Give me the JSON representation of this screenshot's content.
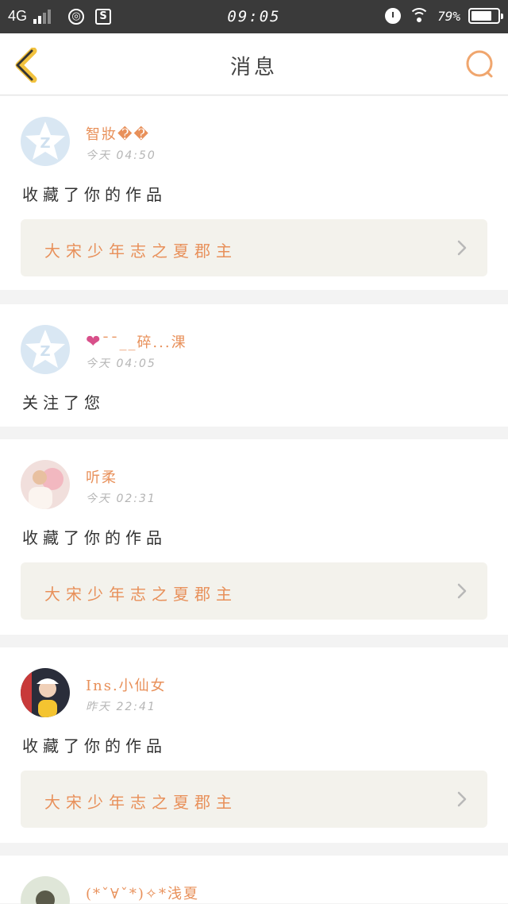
{
  "status_bar": {
    "network": "4G",
    "app1_glyph": "◎",
    "app2_glyph": "S",
    "time": "09:05",
    "battery_text": "79%",
    "battery_level": 0.79
  },
  "header": {
    "title": "消息"
  },
  "icons": {
    "back": "chevron-left-icon",
    "search": "search-icon",
    "chevron": "chevron-right-icon"
  },
  "colors": {
    "accent": "#e8905a",
    "back_icon": "#f2c23e",
    "status_bar_bg": "#3a3a3a",
    "work_bg": "#f3f2ec"
  },
  "notifications": [
    {
      "username": "智妝��",
      "time": "今天 04:50",
      "action": "收藏了你的作品",
      "work_title": "大宋少年志之夏郡主"
    },
    {
      "username_heart": "❤",
      "username": "ˉˉ__碎...淉",
      "time": "今天 04:05",
      "action": "关注了您"
    },
    {
      "username": "听柔",
      "time": "今天 02:31",
      "action": "收藏了你的作品",
      "work_title": "大宋少年志之夏郡主"
    },
    {
      "username": "Ins.小仙女",
      "time": "昨天 22:41",
      "action": "收藏了你的作品",
      "work_title": "大宋少年志之夏郡主"
    },
    {
      "username": "(*ˇ∀ˇ*)✧*浅夏"
    }
  ]
}
